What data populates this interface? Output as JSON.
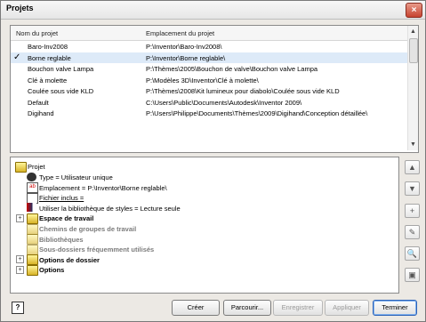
{
  "window": {
    "title": "Projets",
    "close_glyph": "×"
  },
  "columns": {
    "name": "Nom du projet",
    "location": "Emplacement du projet"
  },
  "projects": [
    {
      "name": "Baro-Inv2008",
      "path": "P:\\Inventor\\Baro-Inv2008\\",
      "active": false
    },
    {
      "name": "Borne reglable",
      "path": "P:\\Inventor\\Borne reglable\\",
      "active": true
    },
    {
      "name": "Bouchon valve Lampa",
      "path": "P:\\Thèmes\\2005\\Bouchon de valve\\Bouchon valve Lampa",
      "active": false
    },
    {
      "name": "Clé à molette",
      "path": "P:\\Modèles 3D\\Inventor\\Clé à molette\\",
      "active": false
    },
    {
      "name": "Coulée sous vide KLD",
      "path": "P:\\Thèmes\\2008\\Kit lumineux pour diabolo\\Coulée sous vide KLD",
      "active": false
    },
    {
      "name": "Default",
      "path": "C:\\Users\\Public\\Documents\\Autodesk\\Inventor 2009\\",
      "active": false
    },
    {
      "name": "Digihand",
      "path": "P:\\Users\\Philippe\\Documents\\Thèmes\\2009\\Digihand\\Conception détaillée\\",
      "active": false
    }
  ],
  "check_glyph": "✓",
  "tree": {
    "root": "Projet",
    "type": "Type = Utilisateur unique",
    "location": "Emplacement = P:\\Inventor\\Borne reglable\\",
    "included": "Fichier inclus =",
    "styles": "Utiliser la bibliothèque de styles = Lecture seule",
    "workspace": "Espace de travail",
    "workgroups": "Chemins de groupes de travail",
    "libraries": "Bibliothèques",
    "frequent": "Sous-dossiers fréquemment utilisés",
    "folder_options": "Options de dossier",
    "options": "Options"
  },
  "buttons": {
    "help": "?",
    "create": "Créer",
    "browse": "Parcourir...",
    "save": "Enregistrer",
    "apply": "Appliquer",
    "finish": "Terminer"
  },
  "side_buttons": [
    "▲",
    "▼",
    "+",
    "✎",
    "🔍",
    "▣"
  ],
  "expander": "+",
  "scroll": {
    "up": "▲",
    "down": "▼"
  }
}
